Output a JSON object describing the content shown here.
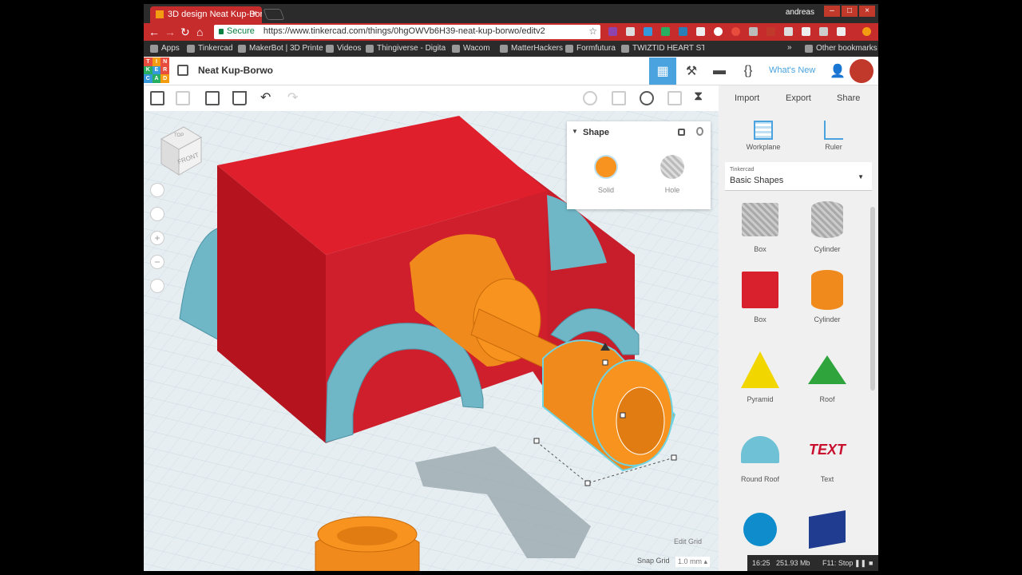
{
  "browser": {
    "tab_title": "3D design Neat Kup-Bor",
    "tab_close": "×",
    "user": "andreas",
    "url_secure": "Secure",
    "url": "https://www.tinkercad.com/things/0hgOWVb6H39-neat-kup-borwo/editv2",
    "window_buttons": [
      "–",
      "□",
      "×"
    ]
  },
  "bookmarks": [
    "Apps",
    "Tinkercad",
    "MakerBot | 3D Printe",
    "Videos",
    "Thingiverse - Digital",
    "Wacom",
    "MatterHackers",
    "Formfutura",
    "TWIZTID HEART STU"
  ],
  "bookmarks_more": "»",
  "bookmarks_other": "Other bookmarks",
  "header": {
    "logo_letters": [
      "TIN",
      "KER",
      "CAD"
    ],
    "design_name": "Neat Kup-Borwo",
    "whats_new": "What's New"
  },
  "rightbar": {
    "import": "Import",
    "export": "Export",
    "share": "Share"
  },
  "view_cube": {
    "top": "TOP",
    "front": "FRONT"
  },
  "inspector": {
    "title": "Shape",
    "solid_label": "Solid",
    "hole_label": "Hole",
    "solid_color": "#f7931e"
  },
  "panel": {
    "workplane": "Workplane",
    "ruler": "Ruler",
    "library_source": "Tinkercad",
    "library_name": "Basic Shapes",
    "shapes": [
      {
        "label": "Box"
      },
      {
        "label": "Cylinder"
      },
      {
        "label": "Box"
      },
      {
        "label": "Cylinder"
      },
      {
        "label": "Pyramid"
      },
      {
        "label": "Roof"
      },
      {
        "label": "Round Roof"
      },
      {
        "label": "Text"
      }
    ],
    "text_sample": "TEXT"
  },
  "workplane": {
    "edit_grid": "Edit Grid",
    "snap_grid_label": "Snap Grid",
    "snap_grid_value": "1.0 mm ▴"
  },
  "status": {
    "time": "16:25",
    "memory": "251.93 Mb",
    "hint": "F11: Stop"
  },
  "colors": {
    "red": "#d0202e",
    "orange": "#f7931e",
    "teal": "#6fb7c7",
    "accent": "#4aa3df"
  }
}
